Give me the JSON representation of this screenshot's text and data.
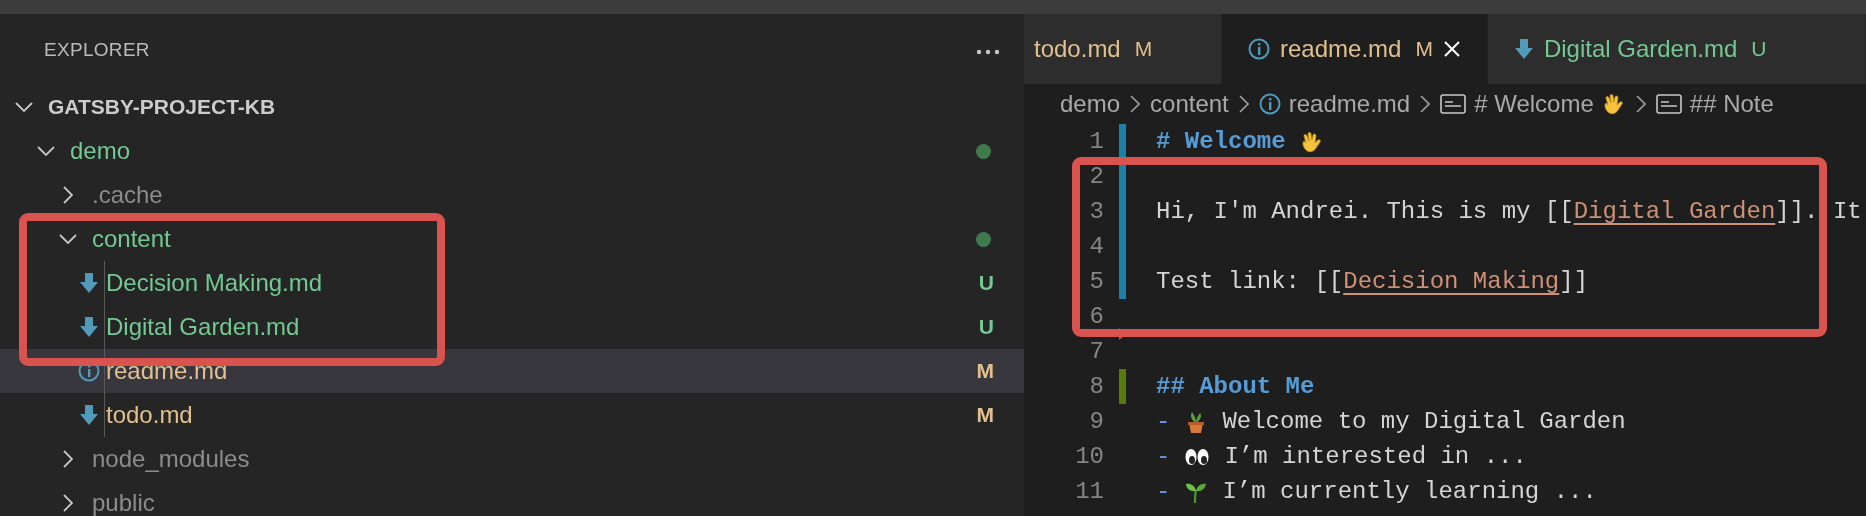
{
  "explorer": {
    "title": "EXPLORER",
    "tree": [
      {
        "label": "GATSBY-PROJECT-KB",
        "kind": "root",
        "expanded": true,
        "selected": false,
        "children": [
          {
            "label": "demo",
            "kind": "folder",
            "color": "#73c991",
            "dot": true,
            "expanded": true,
            "selected": false,
            "children": [
              {
                "label": ".cache",
                "kind": "folder",
                "color": "#8c8c8c",
                "expanded": false,
                "selected": false
              },
              {
                "label": "content",
                "kind": "folder",
                "color": "#73c991",
                "dot": true,
                "expanded": true,
                "selected": false,
                "children": [
                  {
                    "label": "Decision Making.md",
                    "kind": "markdown",
                    "color": "#73c991",
                    "badge": "U",
                    "selected": false
                  },
                  {
                    "label": "Digital Garden.md",
                    "kind": "markdown",
                    "color": "#73c991",
                    "badge": "U",
                    "selected": false
                  },
                  {
                    "label": "readme.md",
                    "kind": "info",
                    "color": "#e2c08d",
                    "badge": "M",
                    "selected": true
                  },
                  {
                    "label": "todo.md",
                    "kind": "markdown",
                    "color": "#e2c08d",
                    "badge": "M",
                    "selected": false
                  }
                ]
              },
              {
                "label": "node_modules",
                "kind": "folder",
                "color": "#8c8c8c",
                "expanded": false,
                "selected": false
              },
              {
                "label": "public",
                "kind": "folder",
                "color": "#8c8c8c",
                "expanded": false,
                "selected": false
              }
            ]
          }
        ]
      }
    ]
  },
  "tabs": [
    {
      "label": "todo.md",
      "kind": "plain",
      "color": "#e2c08d",
      "badge": "M",
      "selected": false
    },
    {
      "label": "readme.md",
      "kind": "info",
      "color": "#e2c08d",
      "badge": "M",
      "selected": true
    },
    {
      "label": "Digital Garden.md",
      "kind": "markdown",
      "color": "#73c991",
      "badge": "U",
      "selected": false
    }
  ],
  "breadcrumbs": [
    {
      "text": "demo",
      "kind": "folder"
    },
    {
      "text": "content",
      "kind": "folder"
    },
    {
      "text": "readme.md",
      "kind": "info"
    },
    {
      "text": "# Welcome",
      "kind": "symbol"
    },
    {
      "text": "## Note",
      "kind": "symbol"
    }
  ],
  "lines": [
    {
      "number": "1",
      "color": "#1b81a8",
      "kind": "heading",
      "parts": [
        {
          "text": "# Welcome"
        }
      ]
    },
    {
      "number": "2",
      "color": "#1b81a8",
      "kind": "blank"
    },
    {
      "number": "3",
      "color": "#1b81a8",
      "kind": "text",
      "parts": [
        {
          "text": "Hi, I'm Andrei. This is my [["
        },
        {
          "text": "Digital Garden",
          "link": true
        },
        {
          "text": "]]. It"
        }
      ]
    },
    {
      "number": "4",
      "color": "#1b81a8",
      "kind": "blank"
    },
    {
      "number": "5",
      "color": "#1b81a8",
      "kind": "text",
      "parts": [
        {
          "text": "Test link: [["
        },
        {
          "text": "Decision Making",
          "link": true
        },
        {
          "text": "]]"
        }
      ]
    },
    {
      "number": "6",
      "color": "#e04646",
      "deleted": true,
      "kind": "blank"
    },
    {
      "number": "7",
      "kind": "blank"
    },
    {
      "number": "8",
      "color": "#587c0c",
      "kind": "heading",
      "parts": [
        {
          "text": "## About Me"
        }
      ]
    },
    {
      "number": "9",
      "kind": "list",
      "bullet": "-",
      "parts": [
        {
          "text": "Welcome to my Digital Garden"
        }
      ]
    },
    {
      "number": "10",
      "kind": "list",
      "bullet": "-",
      "parts": [
        {
          "text": "I’m interested in ..."
        }
      ]
    },
    {
      "number": "11",
      "kind": "list",
      "bullet": "-",
      "parts": [
        {
          "text": "I’m currently learning ..."
        }
      ]
    }
  ],
  "highlights": {
    "explorer_files": true,
    "editor_lines": true
  }
}
